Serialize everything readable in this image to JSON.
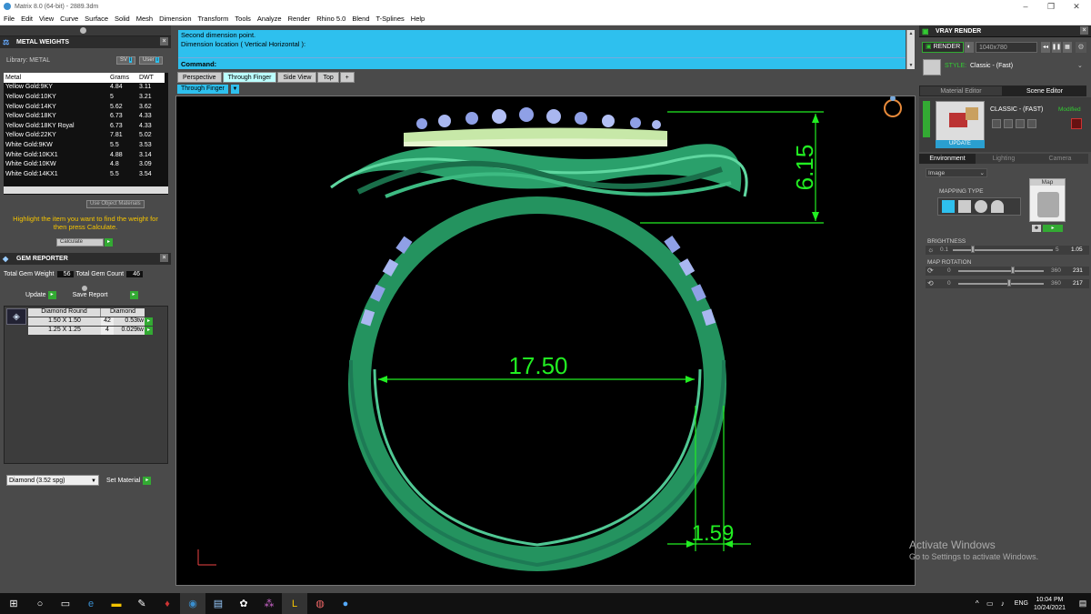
{
  "window": {
    "title": "Matrix 8.0 (64-bit) - 2889.3dm"
  },
  "menu": [
    "File",
    "Edit",
    "View",
    "Curve",
    "Surface",
    "Solid",
    "Mesh",
    "Dimension",
    "Transform",
    "Tools",
    "Analyze",
    "Render",
    "Rhino 5.0",
    "Blend",
    "T-Splines",
    "Help"
  ],
  "metal_weights": {
    "title": "METAL WEIGHTS",
    "library": "Library: METAL",
    "btn_sv": "SV",
    "btn_user": "User",
    "columns": [
      "Metal",
      "Grams",
      "DWT"
    ],
    "rows": [
      [
        "Yellow Gold:9KY",
        "4.84",
        "3.11"
      ],
      [
        "Yellow Gold:10KY",
        "5",
        "3.21"
      ],
      [
        "Yellow Gold:14KY",
        "5.62",
        "3.62"
      ],
      [
        "Yellow Gold:18KY",
        "6.73",
        "4.33"
      ],
      [
        "Yellow Gold:18KY Royal",
        "6.73",
        "4.33"
      ],
      [
        "Yellow Gold:22KY",
        "7.81",
        "5.02"
      ],
      [
        "White Gold:9KW",
        "5.5",
        "3.53"
      ],
      [
        "White Gold:10KX1",
        "4.88",
        "3.14"
      ],
      [
        "White Gold:10KW",
        "4.8",
        "3.09"
      ],
      [
        "White Gold:14KX1",
        "5.5",
        "3.54"
      ]
    ],
    "use_object_materials": "Use Object Materials",
    "hint": "Highlight the item you want to find the weight for then press Calculate.",
    "calculate": "Calculate"
  },
  "gem_reporter": {
    "title": "GEM REPORTER",
    "total_weight_label": "Total Gem Weight",
    "total_weight": "56",
    "total_count_label": "Total Gem Count",
    "total_count": "46",
    "update": "Update",
    "save_report": "Save Report",
    "gem_name": "Diamond Round",
    "gem_type": "Diamond",
    "rows": [
      [
        "1.50 X 1.50",
        "42",
        "0.53tw"
      ],
      [
        "1.25 X 1.25",
        "4",
        "0.029tw"
      ]
    ],
    "material_select": "Diamond    (3.52 spg)",
    "set_material": "Set Material"
  },
  "command": {
    "line1": "Second dimension point.",
    "line2": "Dimension location ( Vertical  Horizontal ):",
    "prompt": "Command:"
  },
  "viewport_tabs": [
    "Perspective",
    "Through Finger",
    "Side View",
    "Top"
  ],
  "active_view": "Through Finger",
  "dimensions": {
    "height": "6.15",
    "inner": "17.50",
    "thickness": "1.59"
  },
  "vray": {
    "title": "VRAY RENDER",
    "render": "RENDER",
    "resolution": "1040x780",
    "style_label": "STYLE:",
    "style": "Classic - (Fast)",
    "tab_material": "Material Editor",
    "tab_scene": "Scene Editor",
    "scene_name": "CLASSIC - (FAST)",
    "scene_modified": "Modified",
    "update": "UPDATE",
    "env_tabs": [
      "Environment",
      "Lighting",
      "Camera"
    ],
    "env_type": "Image",
    "mapping_type": "MAPPING TYPE",
    "map": "Map",
    "brightness_label": "BRIGHTNESS",
    "brightness_min": "0.1",
    "brightness_max": "5",
    "brightness_value": "1.05",
    "brightness_level": 0.2,
    "map_rotation_label": "MAP ROTATION",
    "rot1_min": "0",
    "rot1_max": "360",
    "rot1_value": "231",
    "rot1_level": 0.64,
    "rot2_min": "0",
    "rot2_max": "360",
    "rot2_value": "217",
    "rot2_level": 0.6
  },
  "watermark": {
    "line1": "Activate Windows",
    "line2": "Go to Settings to activate Windows."
  },
  "taskbar": {
    "lang": "ENG",
    "time": "10:04 PM",
    "date": "10/24/2021"
  },
  "colors": {
    "accent": "#2ec0ee",
    "ring_green": "#2fa870",
    "dim_green": "#22ee22"
  }
}
